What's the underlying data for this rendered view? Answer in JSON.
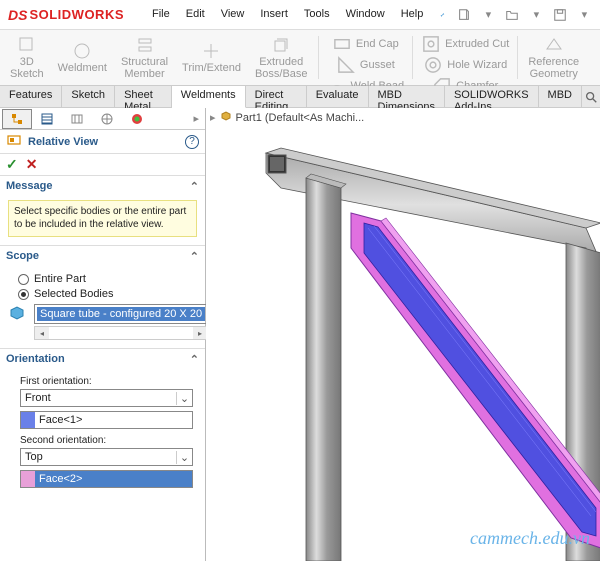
{
  "app": {
    "brand_prefix": "DS",
    "brand_name": "SOLIDWORKS"
  },
  "menu": {
    "file": "File",
    "edit": "Edit",
    "view": "View",
    "insert": "Insert",
    "tools": "Tools",
    "window": "Window",
    "help": "Help"
  },
  "ribbon": {
    "sketch3d": "3D\nSketch",
    "weldment": "Weldment",
    "structural": "Structural\nMember",
    "trim": "Trim/Extend",
    "extruded": "Extruded\nBoss/Base",
    "endcap": "End Cap",
    "gusset": "Gusset",
    "weldbead": "Weld Bead",
    "extcut": "Extruded Cut",
    "holewiz": "Hole Wizard",
    "chamfer": "Chamfer",
    "refgeom": "Reference\nGeometry"
  },
  "tabs": {
    "features": "Features",
    "sketch": "Sketch",
    "sheetmetal": "Sheet Metal",
    "weldments": "Weldments",
    "directedit": "Direct Editing",
    "evaluate": "Evaluate",
    "mbddim": "MBD Dimensions",
    "addins": "SOLIDWORKS Add-Ins",
    "mbd": "MBD"
  },
  "breadcrumb": {
    "part": "Part1  (Default<As Machi..."
  },
  "panel": {
    "title": "Relative View",
    "message_head": "Message",
    "message_body": "Select specific bodies or the entire part to be included in the relative view.",
    "scope_head": "Scope",
    "scope_entire": "Entire Part",
    "scope_selected": "Selected Bodies",
    "selected_item": "Square tube - configured 20 X 20",
    "orient_head": "Orientation",
    "first_label": "First orientation:",
    "first_value": "Front",
    "first_face": "Face<1>",
    "second_label": "Second orientation:",
    "second_value": "Top",
    "second_face": "Face<2>"
  },
  "watermark": "cammech.edu.vn"
}
